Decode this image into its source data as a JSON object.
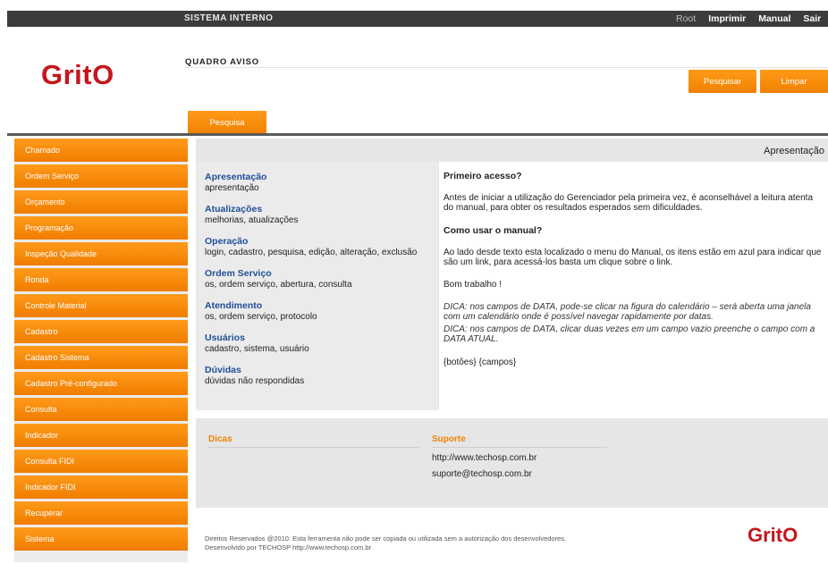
{
  "topbar": {
    "system": "SISTEMA INTERNO",
    "nav": [
      "Root",
      "Imprimir",
      "Manual",
      "Sair"
    ]
  },
  "header": {
    "logo": "GritO",
    "section_title": "QUADRO AVISO",
    "search_button": "Pesquisar",
    "clear_button": "Limpar",
    "tab": "Pesquisa"
  },
  "sidebar": {
    "items": [
      "Chamado",
      "Ordem Serviço",
      "Orçamento",
      "Programação",
      "Inspeção Qualidade",
      "Ronda",
      "Controle Material",
      "Cadastro",
      "Cadastro Sistema",
      "Cadastro Pré-configurado",
      "Consulta",
      "Indicador",
      "Consulta FIDI",
      "Indicador FIDI",
      "Recuperar",
      "Sistema"
    ]
  },
  "panel": {
    "title": "Apresentação",
    "topics": [
      {
        "title": "Apresentação",
        "desc": "apresentação"
      },
      {
        "title": "Atualizações",
        "desc": "melhorias, atualizações"
      },
      {
        "title": "Operação",
        "desc": "login, cadastro, pesquisa, edição, alteração, exclusão"
      },
      {
        "title": "Ordem Serviço",
        "desc": "os, ordem serviço, abertura, consulta"
      },
      {
        "title": "Atendimento",
        "desc": "os, ordem serviço, protocolo"
      },
      {
        "title": "Usuários",
        "desc": "cadastro, sistema, usuário"
      },
      {
        "title": "Dúvidas",
        "desc": "dúvidas não respondidas"
      }
    ],
    "first_access_title": "Primeiro acesso?",
    "first_access_text": "Antes de iniciar a utilização do Gerenciador pela primeira vez, é aconselhável a leitura atenta do manual, para obter os resultados esperados sem dificuldades.",
    "how_to_title": "Como usar o manual?",
    "how_to_text": "Ao lado desde texto esta localizado o menu do Manual, os itens estão em azul para indicar que são um link, para acessá-los basta um clique sobre o link.",
    "good_work": "Bom trabalho !",
    "tip1": "DICA: nos campos de DATA, pode-se clicar na figura do calendário – será aberta uma janela com um calendário onde é possível navegar rapidamente por datas.",
    "tip2": "DICA: nos campos de DATA, clicar duas vezes em um campo vazio preenche o campo com a DATA ATUAL.",
    "links": "{botões}   {campos}"
  },
  "info": {
    "tips_label": "Dicas",
    "support_label": "Suporte",
    "support_url": "http://www.techosp.com.br",
    "support_email": "suporte@techosp.com.br"
  },
  "footer": {
    "line1": "Direitos Reservados @2010. Esta ferramenta não pode ser copiada ou utilizada sem a autorização dos desenvolvedores.",
    "line2": "Desenvolvido por TECHOSP http://www.techosp.com.br",
    "logo": "GritO"
  }
}
